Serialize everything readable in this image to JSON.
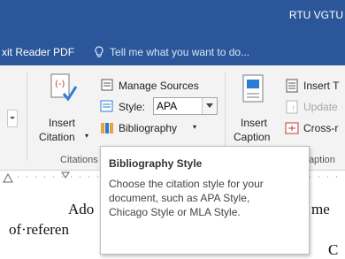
{
  "window": {
    "title": "RTU VGTU"
  },
  "tabs": {
    "partial_tab": "xit Reader PDF"
  },
  "tell_me": {
    "placeholder": "Tell me what you want to do..."
  },
  "ribbon": {
    "citations_group": {
      "insert_citation": "Insert",
      "insert_citation_line2": "Citation",
      "manage_sources": "Manage Sources",
      "style_label": "Style:",
      "style_value": "APA",
      "bibliography": "Bibliography",
      "group_label": "Citations & Bibliography"
    },
    "captions_group": {
      "insert_caption": "Insert",
      "insert_caption_line2": "Caption",
      "insert_table_of_figures": "Insert T",
      "update_table": "Update",
      "cross_reference": "Cross-r",
      "group_label": "Caption"
    }
  },
  "document": {
    "line1_left": "Ado",
    "line1_right": "me",
    "line2_left": "of·referen",
    "line3_right": "C"
  },
  "tooltip": {
    "title": "Bibliography Style",
    "body": "Choose the citation style for your\ndocument, such as APA Style,\nChicago Style or MLA Style."
  },
  "colors": {
    "accent": "#2b579a",
    "ribbon_bg": "#f3f3f3"
  }
}
